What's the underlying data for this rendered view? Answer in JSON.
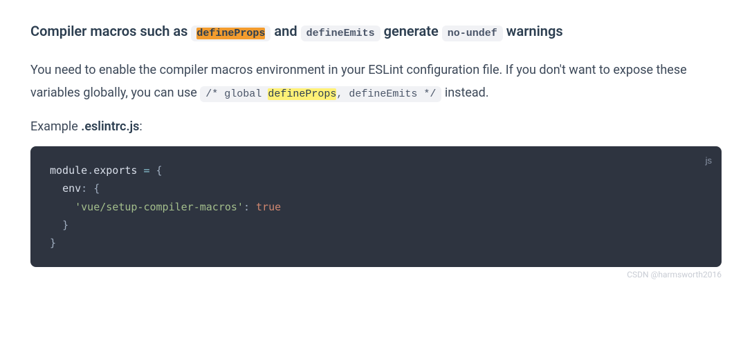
{
  "heading": {
    "part1": "Compiler macros such as ",
    "code1": "defineProps",
    "part2": " and ",
    "code2": "defineEmits",
    "part3": " generate ",
    "code3": "no-undef",
    "part4": " warnings"
  },
  "paragraph": {
    "part1": "You need to enable the compiler macros environment in your ESLint configuration file. If you don't want to expose these variables globally, you can use ",
    "comment_open": "/* global ",
    "comment_hl": "defineProps",
    "comment_rest": ", defineEmits */",
    "part2": " instead."
  },
  "example": {
    "prefix": "Example ",
    "filename": ".eslintrc.js",
    "suffix": ":"
  },
  "code": {
    "lang": "js",
    "l1_ident": "module",
    "l1_dot": ".",
    "l1_exports": "exports",
    "l1_eq": " = ",
    "l1_brace": "{",
    "l2_key": "env",
    "l2_colon": ": ",
    "l2_brace": "{",
    "l3_string": "'vue/setup-compiler-macros'",
    "l3_colon": ": ",
    "l3_bool": "true",
    "l4_brace": "}",
    "l5_brace": "}"
  },
  "watermark": "CSDN @harmsworth2016"
}
